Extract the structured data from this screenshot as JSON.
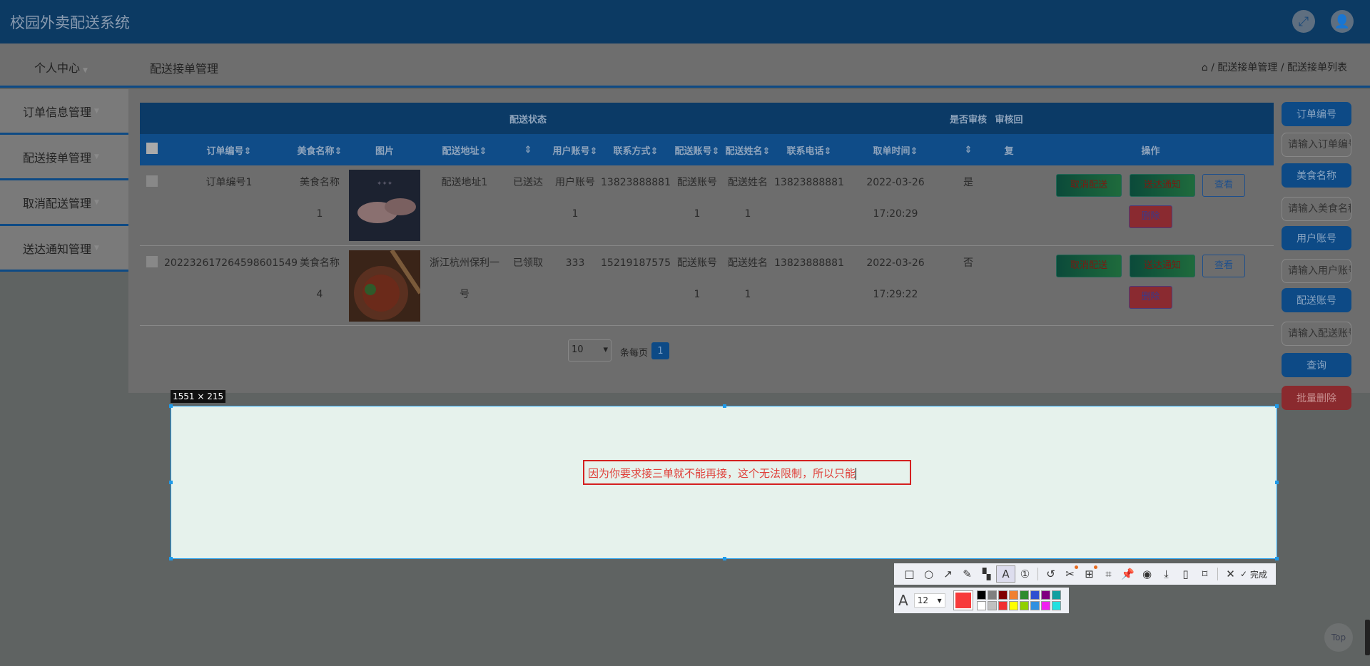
{
  "header": {
    "title": "校园外卖配送系统",
    "fullscreen_icon": "expand-icon",
    "user_icon": "user-icon"
  },
  "topbar": {
    "personal": "个人中心",
    "page_title": "配送接单管理",
    "breadcrumb": [
      "配送接单管理",
      "配送接单列表"
    ]
  },
  "sidebar": {
    "items": [
      {
        "label": "订单信息管理"
      },
      {
        "label": "配送接单管理"
      },
      {
        "label": "取消配送管理"
      },
      {
        "label": "送达通知管理"
      }
    ]
  },
  "table": {
    "group_headers": {
      "status": "配送状态",
      "review": "是否审核",
      "reply": "审核回"
    },
    "columns": [
      "订单编号",
      "美食名称",
      "图片",
      "配送地址",
      "",
      "用户账号",
      "联系方式",
      "配送账号",
      "配送姓名",
      "联系电话",
      "取单时间",
      "",
      "复",
      "操作"
    ],
    "rows": [
      {
        "order_no": "订单编号1",
        "food": [
          "美食名称",
          "1"
        ],
        "address": [
          "配送地址1"
        ],
        "status": "已送达",
        "user": [
          "用户账号",
          "1"
        ],
        "contact": "13823888881",
        "rider_acct": [
          "配送账号",
          "1"
        ],
        "rider_name": [
          "配送姓名",
          "1"
        ],
        "phone": "13823888881",
        "time": [
          "2022-03-26",
          "17:20:29"
        ],
        "reviewed": "是",
        "reply": ""
      },
      {
        "order_no": "202232617264598601549",
        "food": [
          "美食名称",
          "4"
        ],
        "address": [
          "浙江杭州保利一",
          "号"
        ],
        "status": "已领取",
        "user": [
          "333"
        ],
        "contact": "15219187575",
        "rider_acct": [
          "配送账号",
          "1"
        ],
        "rider_name": [
          "配送姓名",
          "1"
        ],
        "phone": "13823888881",
        "time": [
          "2022-03-26",
          "17:29:22"
        ],
        "reviewed": "否",
        "reply": ""
      }
    ],
    "actions": {
      "cancel": "取消配送",
      "notify": "送达通知",
      "view": "查看",
      "delete": "删除"
    }
  },
  "pagination": {
    "page_size": "10",
    "per_page_label": "条每页",
    "current_page": "1"
  },
  "search": {
    "order_no_label": "订单编号",
    "order_no_placeholder": "请输入订单编号",
    "food_label": "美食名称",
    "food_placeholder": "请输入美食名称",
    "user_label": "用户账号",
    "user_placeholder": "请输入用户账号",
    "rider_label": "配送账号",
    "rider_placeholder": "请输入配送账号",
    "query": "查询",
    "batch_delete": "批量删除"
  },
  "capture": {
    "size": "1551 × 215",
    "text": "因为你要求接三单就不能再接，这个无法限制，所以只能",
    "done": "完成",
    "font_size": "12",
    "current_color": "#f73a3a",
    "palette": [
      "#000000",
      "#808080",
      "#800000",
      "#f08030",
      "#2e8b2e",
      "#3050d0",
      "#800080",
      "#10a0a0",
      "#ffffff",
      "#c0c0c0",
      "#f03030",
      "#ffff00",
      "#90d000",
      "#3090e0",
      "#f020f0",
      "#20e0e0"
    ]
  },
  "top_button": "Top"
}
